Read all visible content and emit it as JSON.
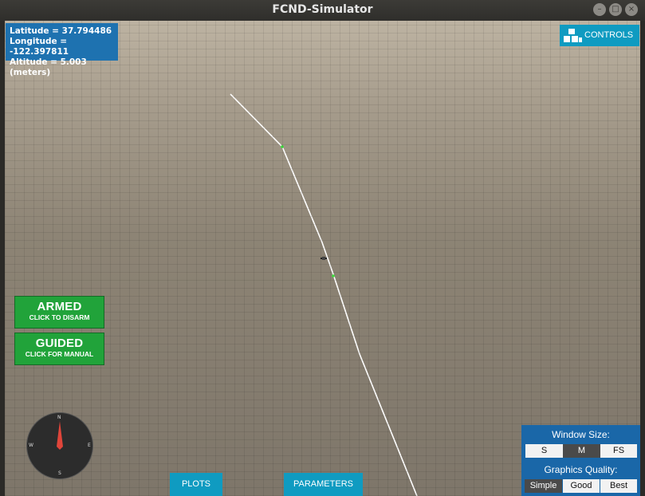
{
  "window": {
    "title": "FCND-Simulator",
    "minimize_glyph": "–",
    "maximize_glyph": "□",
    "close_glyph": "×"
  },
  "telemetry": {
    "latitude": "Latitude = 37.794486",
    "longitude": "Longitude = -122.397811",
    "altitude": "Altitude = 5.003 (meters)"
  },
  "controls_button": {
    "label": "CONTROLS",
    "icon": "boxes-icon"
  },
  "arm_button": {
    "title": "ARMED",
    "subtitle": "CLICK TO DISARM",
    "color": "#21a33a"
  },
  "mode_button": {
    "title": "GUIDED",
    "subtitle": "CLICK FOR MANUAL",
    "color": "#21a33a"
  },
  "compass": {
    "north": "N",
    "south": "S",
    "east": "E",
    "west": "W",
    "needle_color": "#e0453a"
  },
  "bottom_tabs": {
    "plots": "PLOTS",
    "parameters": "PARAMETERS"
  },
  "settings_panel": {
    "window_size_label": "Window Size:",
    "window_sizes": [
      "S",
      "M",
      "FS"
    ],
    "window_size_selected": "M",
    "graphics_label": "Graphics Quality:",
    "graphics_options": [
      "Simple",
      "Good",
      "Best"
    ],
    "graphics_selected": "Simple"
  },
  "colors": {
    "accent": "#0f9bc1",
    "panel": "#1a67a8",
    "telemetry_bg": "#1e72b0",
    "waypoint": "#3ddc3d",
    "path": "#ffffff"
  }
}
